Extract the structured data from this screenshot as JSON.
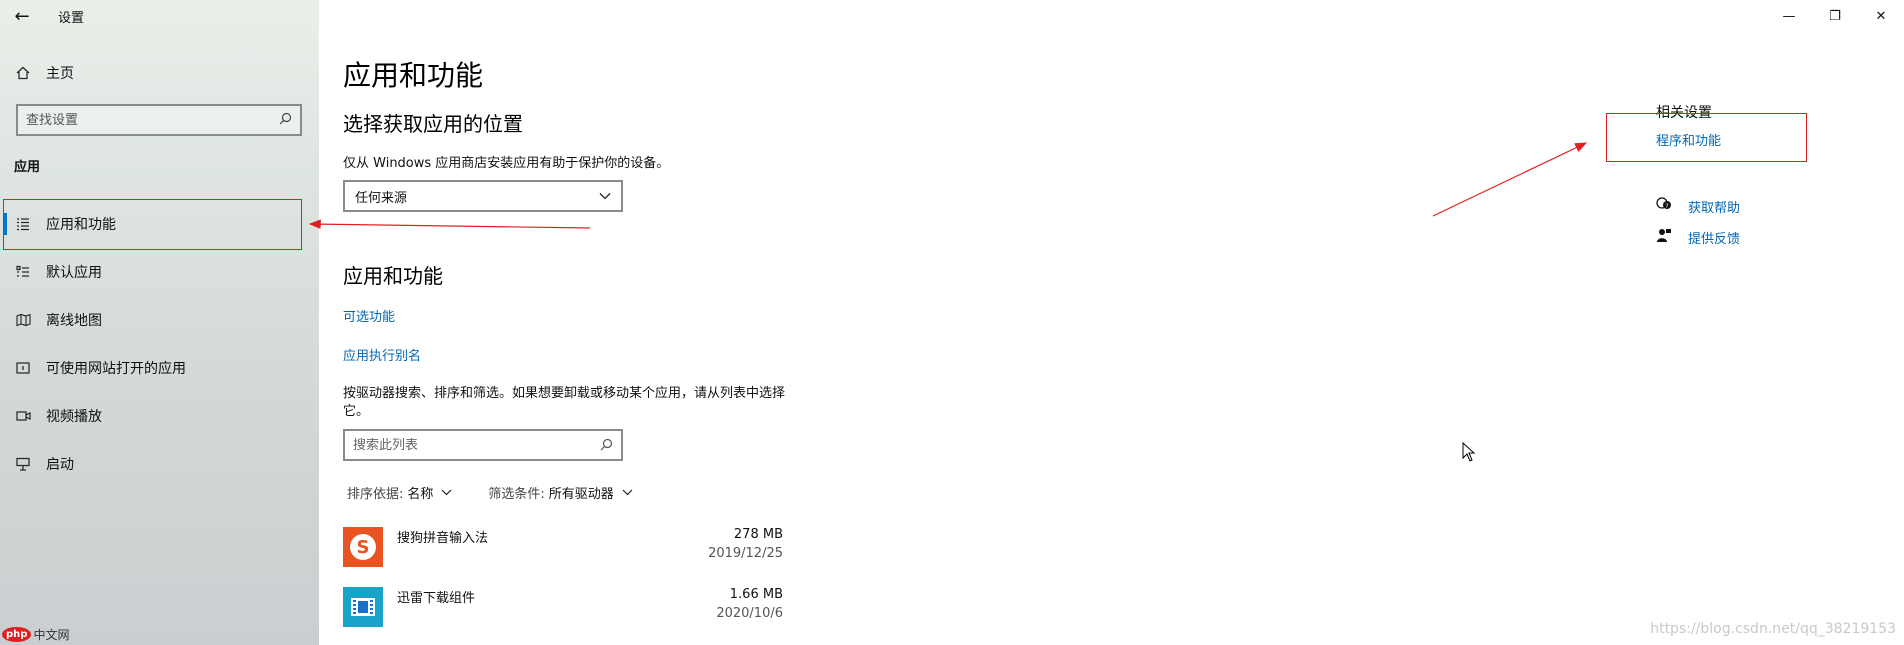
{
  "window": {
    "title": "设置",
    "back_glyph": "←",
    "controls": {
      "minimize": "—",
      "maximize": "❐",
      "close": "✕"
    }
  },
  "sidebar": {
    "home_label": "主页",
    "search_placeholder": "查找设置",
    "section": "应用",
    "items": [
      {
        "label": "应用和功能",
        "icon": "apps-list-icon",
        "selected": true
      },
      {
        "label": "默认应用",
        "icon": "default-apps-icon"
      },
      {
        "label": "离线地图",
        "icon": "map-icon"
      },
      {
        "label": "可使用网站打开的应用",
        "icon": "web-apps-icon"
      },
      {
        "label": "视频播放",
        "icon": "video-icon"
      },
      {
        "label": "启动",
        "icon": "startup-icon"
      }
    ]
  },
  "main": {
    "title": "应用和功能",
    "choose_section": {
      "heading": "选择获取应用的位置",
      "description": "仅从 Windows 应用商店安装应用有助于保护你的设备。",
      "dropdown_value": "任何来源"
    },
    "apps_section": {
      "heading": "应用和功能",
      "link_optional": "可选功能",
      "link_alias": "应用执行别名",
      "paragraph": "按驱动器搜索、排序和筛选。如果想要卸载或移动某个应用，请从列表中选择它。",
      "search_placeholder": "搜索此列表",
      "sort_label": "排序依据:",
      "sort_value": "名称",
      "filter_label": "筛选条件:",
      "filter_value": "所有驱动器",
      "apps": [
        {
          "name": "搜狗拼音输入法",
          "size": "278 MB",
          "date": "2019/12/25",
          "icon": "sogou-icon",
          "color": "#e8531f"
        },
        {
          "name": "迅雷下载组件",
          "size": "1.66 MB",
          "date": "2020/10/6",
          "icon": "xunlei-icon",
          "color": "#1aa3c9"
        }
      ]
    }
  },
  "related": {
    "title": "相关设置",
    "link": "程序和功能",
    "help": "获取帮助",
    "feedback": "提供反馈"
  },
  "watermark": "https://blog.csdn.net/qq_38219153",
  "php_logo": {
    "badge": "php",
    "text": "中文网"
  },
  "annotation_color": "#e02020"
}
